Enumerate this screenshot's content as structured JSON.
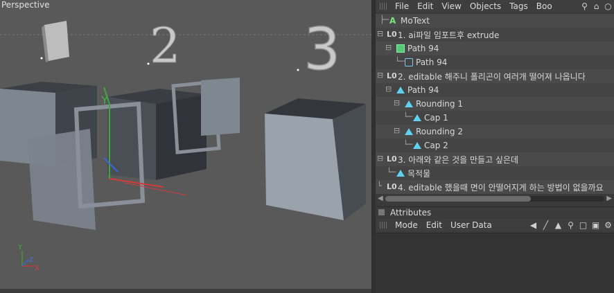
{
  "viewport": {
    "title": "Perspective",
    "numbers": [
      "1",
      "2",
      "3"
    ],
    "axis_labels": {
      "y": "Y",
      "z": "Z",
      "x": "X"
    },
    "gizmo_label": "Y"
  },
  "object_manager": {
    "menu": [
      "File",
      "Edit",
      "View",
      "Objects",
      "Tags",
      "Boo"
    ],
    "tools": [
      "search-icon",
      "home-icon",
      "eye-icon"
    ],
    "rows": [
      {
        "label": "MoText",
        "icon": "motext-icon",
        "indent": 0
      },
      {
        "label": "1. ai파일 임포트후 extrude",
        "icon": "null-icon",
        "indent": 0
      },
      {
        "label": "Path 94",
        "icon": "extrude-icon",
        "indent": 1
      },
      {
        "label": "Path 94",
        "icon": "spline-icon",
        "indent": 2
      },
      {
        "label": "2. editable 해주니 폴리곤이 여러개 떨어져 나옵니다",
        "icon": "null-icon",
        "indent": 0
      },
      {
        "label": "Path 94",
        "icon": "polygon-icon",
        "indent": 1
      },
      {
        "label": "Rounding 1",
        "icon": "polygon-icon",
        "indent": 2
      },
      {
        "label": "Cap 1",
        "icon": "polygon-icon",
        "indent": 3
      },
      {
        "label": "Rounding 2",
        "icon": "polygon-icon",
        "indent": 2
      },
      {
        "label": "Cap 2",
        "icon": "polygon-icon",
        "indent": 3
      },
      {
        "label": "3. 아래와 같은 것을 만들고 싶은데",
        "icon": "null-icon",
        "indent": 0
      },
      {
        "label": "목적물",
        "icon": "polygon-icon",
        "indent": 1
      },
      {
        "label": "4. editable 했을때 면이 안떨어지게 하는 방법이 없을까요",
        "icon": "null-icon",
        "indent": 0
      }
    ]
  },
  "attributes": {
    "title": "Attributes",
    "menu": [
      "Mode",
      "Edit",
      "User Data"
    ],
    "tools": [
      "back-arrow-icon",
      "forward-arrow-icon",
      "up-arrow-icon",
      "search-icon",
      "lock-icon",
      "new-panel-icon",
      "settings-icon"
    ]
  },
  "colors": {
    "viewport_bg": "#595959",
    "panel_bg": "#454545",
    "polygon_icon": "#5fd0f0",
    "motext_icon": "#7ee07e"
  }
}
